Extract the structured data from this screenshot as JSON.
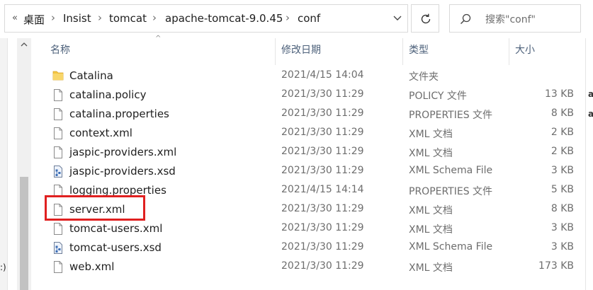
{
  "address_bar": {
    "overflow_glyph": "«",
    "breadcrumbs": [
      "桌面",
      "Insist",
      "tomcat",
      "apache-tomcat-9.0.45",
      "conf"
    ],
    "separator": "›"
  },
  "search": {
    "placeholder": "搜索\"conf\""
  },
  "columns": {
    "name": "名称",
    "modified": "修改日期",
    "type": "类型",
    "size": "大小"
  },
  "files": [
    {
      "name": "Catalina",
      "modified": "2021/4/15 14:04",
      "type": "文件夹",
      "size": "",
      "icon": "folder-icon"
    },
    {
      "name": "catalina.policy",
      "modified": "2021/3/30 11:29",
      "type": "POLICY 文件",
      "size": "13 KB",
      "icon": "file-icon"
    },
    {
      "name": "catalina.properties",
      "modified": "2021/3/30 11:29",
      "type": "PROPERTIES 文件",
      "size": "8 KB",
      "icon": "file-icon"
    },
    {
      "name": "context.xml",
      "modified": "2021/3/30 11:29",
      "type": "XML 文档",
      "size": "2 KB",
      "icon": "file-icon"
    },
    {
      "name": "jaspic-providers.xml",
      "modified": "2021/3/30 11:29",
      "type": "XML 文档",
      "size": "2 KB",
      "icon": "file-icon"
    },
    {
      "name": "jaspic-providers.xsd",
      "modified": "2021/3/30 11:29",
      "type": "XML Schema File",
      "size": "3 KB",
      "icon": "xsd-file-icon"
    },
    {
      "name": "logging.properties",
      "modified": "2021/4/15 14:14",
      "type": "PROPERTIES 文件",
      "size": "5 KB",
      "icon": "file-icon"
    },
    {
      "name": "server.xml",
      "modified": "2021/3/30 11:29",
      "type": "XML 文档",
      "size": "8 KB",
      "icon": "file-icon"
    },
    {
      "name": "tomcat-users.xml",
      "modified": "2021/3/30 11:29",
      "type": "XML 文档",
      "size": "3 KB",
      "icon": "file-icon"
    },
    {
      "name": "tomcat-users.xsd",
      "modified": "2021/3/30 11:29",
      "type": "XML Schema File",
      "size": "3 KB",
      "icon": "xsd-file-icon"
    },
    {
      "name": "web.xml",
      "modified": "2021/3/30 11:29",
      "type": "XML 文档",
      "size": "173 KB",
      "icon": "file-icon"
    }
  ],
  "left_panel_fragment": ":)",
  "right_panel_fragments": [
    "a",
    "a"
  ],
  "colors": {
    "highlight": "#e02020",
    "header_text": "#4c607a",
    "folder": "#f4c542"
  }
}
